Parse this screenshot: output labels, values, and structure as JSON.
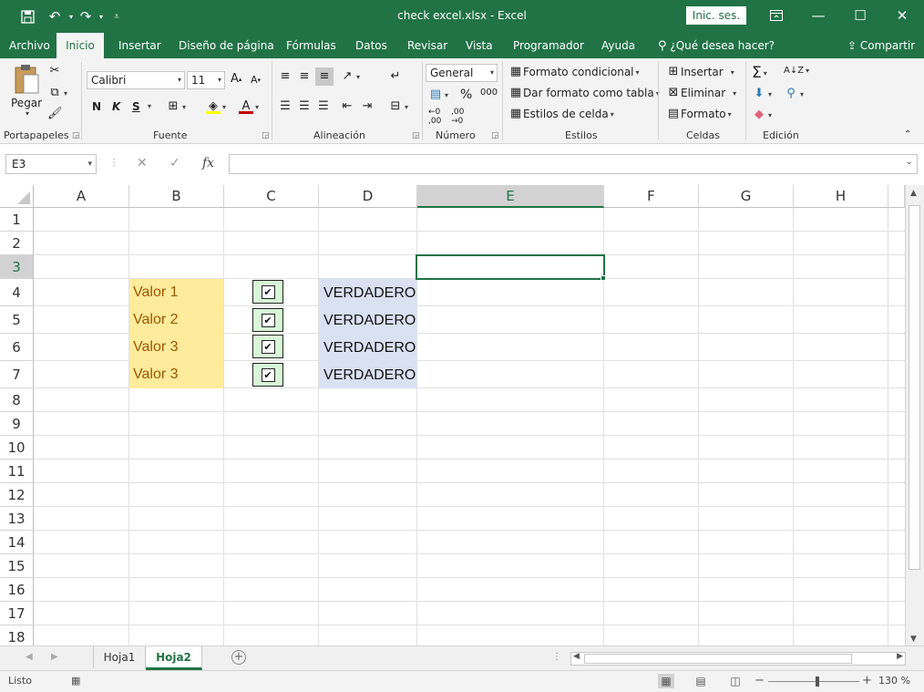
{
  "window": {
    "title": "check excel.xlsx  -  Excel",
    "signin": "Inic. ses.",
    "accent": "#217346",
    "icons": [
      "save-icon",
      "undo-icon",
      "redo-icon",
      "customize-qat-icon",
      "ribbon-display-icon",
      "minimize-icon",
      "maximize-icon",
      "close-icon"
    ]
  },
  "tabs": [
    {
      "label": "Archivo"
    },
    {
      "label": "Inicio",
      "active": true
    },
    {
      "label": "Insertar"
    },
    {
      "label": "Diseño de página"
    },
    {
      "label": "Fórmulas"
    },
    {
      "label": "Datos"
    },
    {
      "label": "Revisar"
    },
    {
      "label": "Vista"
    },
    {
      "label": "Programador"
    },
    {
      "label": "Ayuda"
    }
  ],
  "tell_me": "¿Qué desea hacer?",
  "share": "Compartir",
  "ribbon": {
    "clipboard": {
      "paste": "Pegar",
      "label": "Portapapeles"
    },
    "font": {
      "name": "Calibri",
      "size": "11",
      "bold": "N",
      "italic": "K",
      "underline": "S",
      "label": "Fuente"
    },
    "alignment": {
      "label": "Alineación"
    },
    "number": {
      "format": "General",
      "label": "Número"
    },
    "styles": {
      "conditional": "Formato condicional",
      "table": "Dar formato como tabla",
      "cell_styles": "Estilos de celda",
      "label": "Estilos"
    },
    "cells": {
      "insert": "Insertar",
      "delete": "Eliminar",
      "format": "Formato",
      "label": "Celdas"
    },
    "editing": {
      "label": "Edición"
    }
  },
  "formula_bar": {
    "name_box": "E3",
    "fx": "fx",
    "value": ""
  },
  "grid": {
    "columns": [
      "A",
      "B",
      "C",
      "D",
      "E",
      "F",
      "G",
      "H"
    ],
    "selected_column": "E",
    "rows": [
      "1",
      "2",
      "3",
      "4",
      "5",
      "6",
      "7",
      "8",
      "9",
      "10",
      "11",
      "12",
      "13",
      "14",
      "15",
      "16",
      "17",
      "18"
    ],
    "selected_row": "3",
    "values_b": [
      "Valor 1",
      "Valor 2",
      "Valor 3",
      "Valor 3"
    ],
    "values_d": [
      "VERDADERO",
      "VERDADERO",
      "VERDADERO",
      "VERDADERO"
    ],
    "checkbox_mark": "✔",
    "colors": {
      "b_fill": "#ffeb9c",
      "b_text": "#9c5700",
      "d_fill": "#d9e1f2",
      "checkbox_fill": "#d7f7d7"
    }
  },
  "sheets": [
    {
      "name": "Hoja1"
    },
    {
      "name": "Hoja2",
      "active": true
    }
  ],
  "status": {
    "ready": "Listo",
    "zoom": "130 %"
  }
}
